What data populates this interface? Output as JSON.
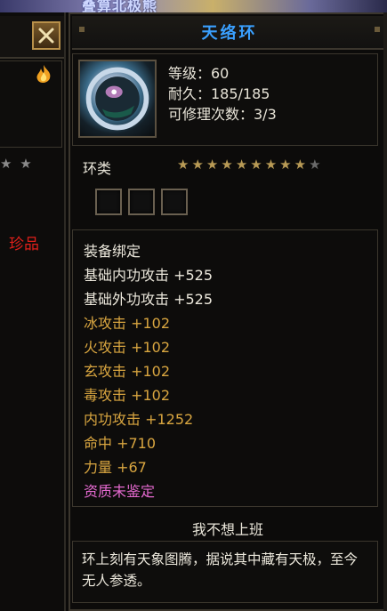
{
  "background": {
    "banner_text": "叠算北极熊"
  },
  "left_panel": {
    "rarity_label": "珍品",
    "stars": "★ ★"
  },
  "item": {
    "name": "天络环",
    "level": "等级：60",
    "durability": "耐久：185/185",
    "repair_count": "可修理次数：3/3",
    "type": "环类",
    "star_rating": 9,
    "star_total": 10,
    "socket_count": 3
  },
  "attributes": [
    {
      "text": "装备绑定",
      "color": "white"
    },
    {
      "text": "基础内功攻击 +525",
      "color": "white"
    },
    {
      "text": "基础外功攻击 +525",
      "color": "white"
    },
    {
      "text": "冰攻击 +102",
      "color": "gold"
    },
    {
      "text": "火攻击 +102",
      "color": "gold"
    },
    {
      "text": "玄攻击 +102",
      "color": "gold"
    },
    {
      "text": "毒攻击 +102",
      "color": "gold"
    },
    {
      "text": "内功攻击 +1252",
      "color": "gold"
    },
    {
      "text": "命中 +710",
      "color": "gold"
    },
    {
      "text": "力量 +67",
      "color": "gold"
    },
    {
      "text": "资质未鉴定",
      "color": "pink"
    }
  ],
  "maker": "我不想上班",
  "description": "环上刻有天象图腾，据说其中藏有天极，至今无人参透。",
  "colors": {
    "title": "#3aa0ff",
    "gold": "#d9a640",
    "pink": "#e56ad0",
    "rarity": "#e0201a",
    "star_on": "#b89a55",
    "star_off": "#6a6a6a"
  }
}
